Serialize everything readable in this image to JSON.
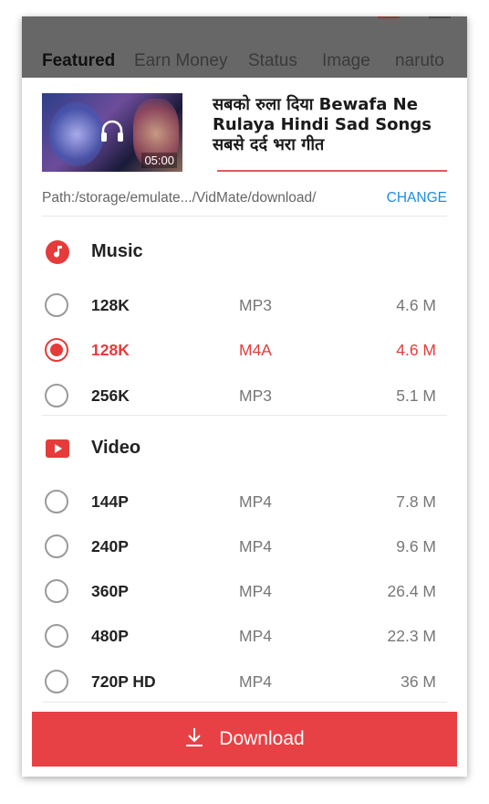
{
  "tabs": [
    {
      "label": "Featured",
      "active": true
    },
    {
      "label": "Earn Money",
      "active": false
    },
    {
      "label": "Status",
      "active": false
    },
    {
      "label": "Image",
      "active": false
    },
    {
      "label": "naruto",
      "active": false
    }
  ],
  "video": {
    "duration": "05:00",
    "title_lines": [
      "सबको रुला दिया  Bewafa Ne",
      "Rulaya   Hindi Sad Songs",
      "सबसे दर्द भरा गीत"
    ]
  },
  "path": {
    "text": "Path:/storage/emulate.../VidMate/download/",
    "change_label": "CHANGE"
  },
  "music": {
    "title": "Music",
    "options": [
      {
        "quality": "128K",
        "format": "MP3",
        "size": "4.6 M",
        "selected": false
      },
      {
        "quality": "128K",
        "format": "M4A",
        "size": "4.6 M",
        "selected": true
      },
      {
        "quality": "256K",
        "format": "MP3",
        "size": "5.1 M",
        "selected": false
      }
    ]
  },
  "video_section": {
    "title": "Video",
    "options": [
      {
        "quality": "144P",
        "format": "MP4",
        "size": "7.8 M",
        "selected": false
      },
      {
        "quality": "240P",
        "format": "MP4",
        "size": "9.6 M",
        "selected": false
      },
      {
        "quality": "360P",
        "format": "MP4",
        "size": "26.4 M",
        "selected": false
      },
      {
        "quality": "480P",
        "format": "MP4",
        "size": "22.3 M",
        "selected": false
      },
      {
        "quality": "720P HD",
        "format": "MP4",
        "size": "36 M",
        "selected": false
      }
    ]
  },
  "download": {
    "label": "Download"
  },
  "colors": {
    "accent": "#e53b3b",
    "link": "#1a8ee0",
    "topbar": "#676767"
  },
  "icons": {
    "music": "music-note-icon",
    "video": "play-icon",
    "download": "download-icon",
    "thumb_overlay": "headphones-icon"
  }
}
